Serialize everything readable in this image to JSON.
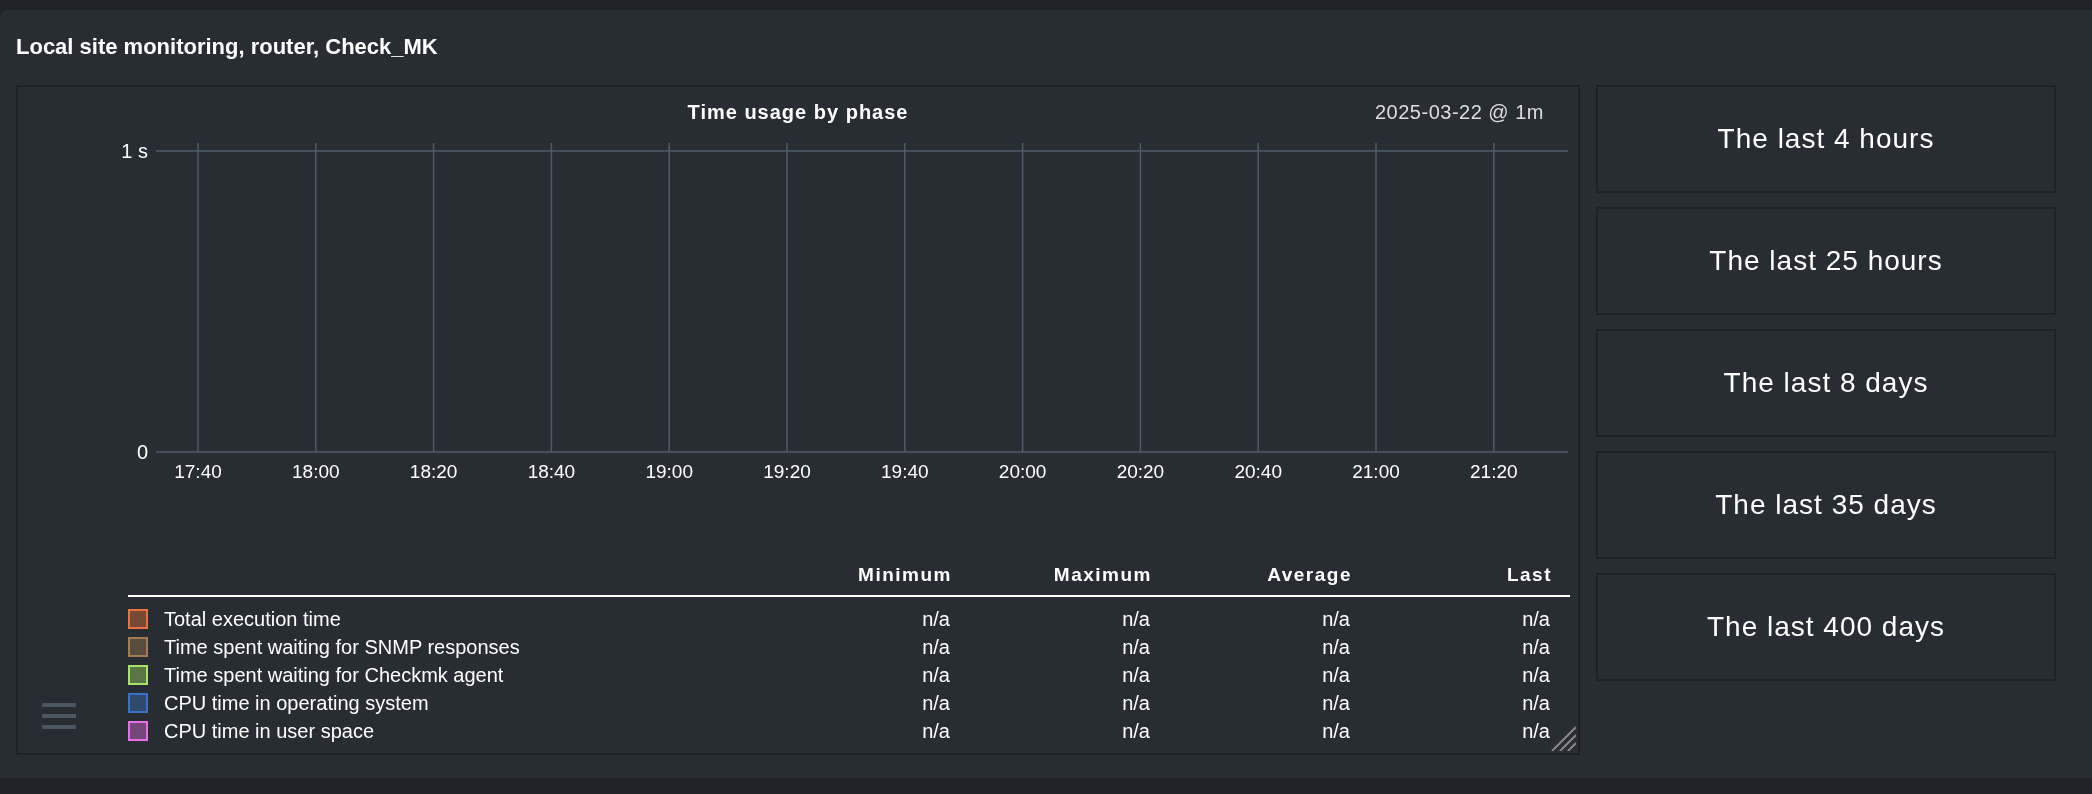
{
  "panel": {
    "title": "Local site monitoring, router, Check_MK"
  },
  "graph": {
    "timestamp": "2025-03-22 @ 1m",
    "chart_data": {
      "type": "line",
      "grid": true,
      "title": "Time usage by phase",
      "categories": [
        "17:40",
        "18:00",
        "18:20",
        "18:40",
        "19:00",
        "19:20",
        "19:40",
        "20:00",
        "20:20",
        "20:40",
        "21:00",
        "21:20"
      ],
      "ylim": [
        0,
        1
      ],
      "yticks": [
        0,
        {
          "value": 1,
          "label": "1 s"
        }
      ]
    },
    "legend": {
      "columns": [
        "Minimum",
        "Maximum",
        "Average",
        "Last"
      ],
      "rows": [
        {
          "name": "Total execution time",
          "color": "#e8733c",
          "values": [
            "n/a",
            "n/a",
            "n/a",
            "n/a"
          ]
        },
        {
          "name": "Time spent waiting for SNMP responses",
          "color": "#a57c4f",
          "values": [
            "n/a",
            "n/a",
            "n/a",
            "n/a"
          ]
        },
        {
          "name": "Time spent waiting for Checkmk agent",
          "color": "#a6e366",
          "values": [
            "n/a",
            "n/a",
            "n/a",
            "n/a"
          ]
        },
        {
          "name": "CPU time in operating system",
          "color": "#3b72c9",
          "values": [
            "n/a",
            "n/a",
            "n/a",
            "n/a"
          ]
        },
        {
          "name": "CPU time in user space",
          "color": "#e66ee6",
          "values": [
            "n/a",
            "n/a",
            "n/a",
            "n/a"
          ]
        }
      ]
    }
  },
  "timeranges": [
    "The last 4 hours",
    "The last 25 hours",
    "The last 8 days",
    "The last 35 days",
    "The last 400 days"
  ]
}
